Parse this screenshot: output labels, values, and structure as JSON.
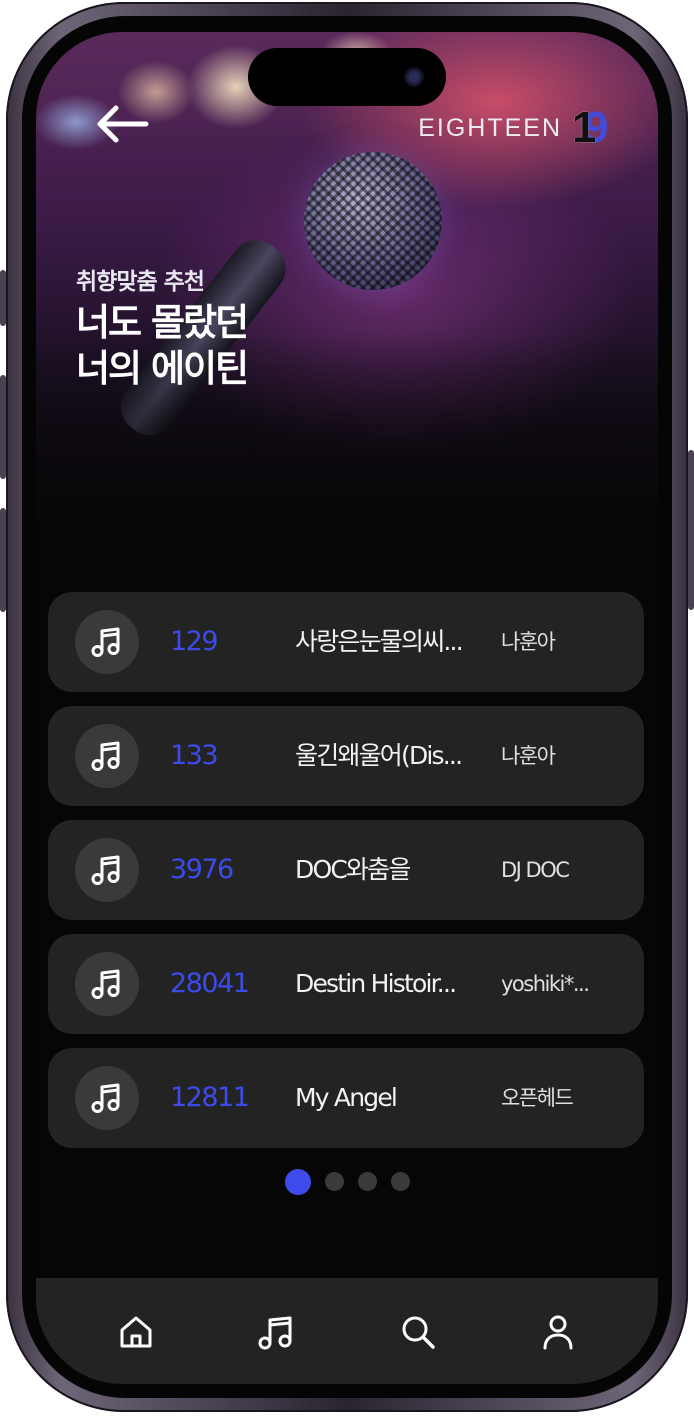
{
  "header": {
    "back_icon": "arrow-left-icon",
    "brand_name": "EIGHTEEN",
    "logo_digit_one": "1",
    "logo_digit_nine": "9"
  },
  "hero": {
    "subtitle": "취향맞춤 추천",
    "title_line1": "너도 몰랐던",
    "title_line2": "너의 에이틴"
  },
  "songs": [
    {
      "number": "129",
      "title": "사랑은눈물의씨...",
      "artist": "나훈아",
      "icon": "music-note-icon"
    },
    {
      "number": "133",
      "title": "울긴왜울어(Dis...",
      "artist": "나훈아",
      "icon": "music-note-icon"
    },
    {
      "number": "3976",
      "title": "DOC와춤을",
      "artist": "DJ DOC",
      "icon": "music-note-icon"
    },
    {
      "number": "28041",
      "title": "Destin Histoir...",
      "artist": "yoshiki*...",
      "icon": "music-note-icon"
    },
    {
      "number": "12811",
      "title": "My Angel",
      "artist": "오픈헤드",
      "icon": "music-note-icon"
    }
  ],
  "pagination": {
    "total_pages": 4,
    "current_page": 1
  },
  "tabbar": {
    "items": [
      {
        "icon": "home-icon"
      },
      {
        "icon": "music-note-icon"
      },
      {
        "icon": "search-icon"
      },
      {
        "icon": "user-icon"
      }
    ]
  },
  "colors": {
    "accent": "#3c4bea",
    "row_background": "#232323",
    "screen_background": "#060606"
  }
}
